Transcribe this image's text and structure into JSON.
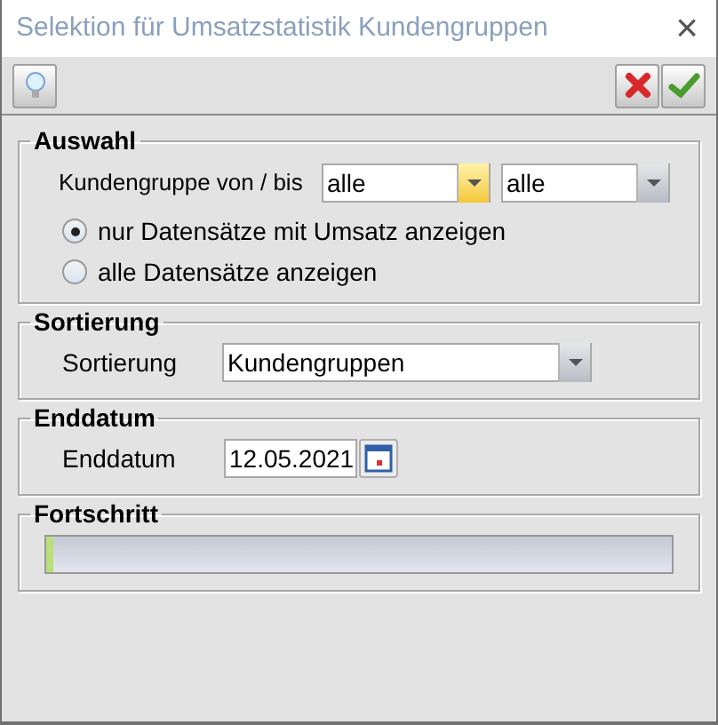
{
  "window": {
    "title": "Selektion für Umsatzstatistik Kundengruppen",
    "close": "×"
  },
  "auswahl": {
    "title": "Auswahl",
    "label": "Kundengruppe von / bis",
    "from": {
      "value": "alle",
      "focused": true
    },
    "to": {
      "value": "alle",
      "focused": false
    },
    "options": [
      {
        "label": "nur Datensätze mit Umsatz anzeigen",
        "selected": true
      },
      {
        "label": "alle Datensätze anzeigen",
        "selected": false
      }
    ]
  },
  "sortierung": {
    "title": "Sortierung",
    "label": "Sortierung",
    "value": "Kundengruppen"
  },
  "enddatum": {
    "title": "Enddatum",
    "label": "Enddatum",
    "value": "12.05.2021"
  },
  "fortschritt": {
    "title": "Fortschritt",
    "level": 0.01
  }
}
